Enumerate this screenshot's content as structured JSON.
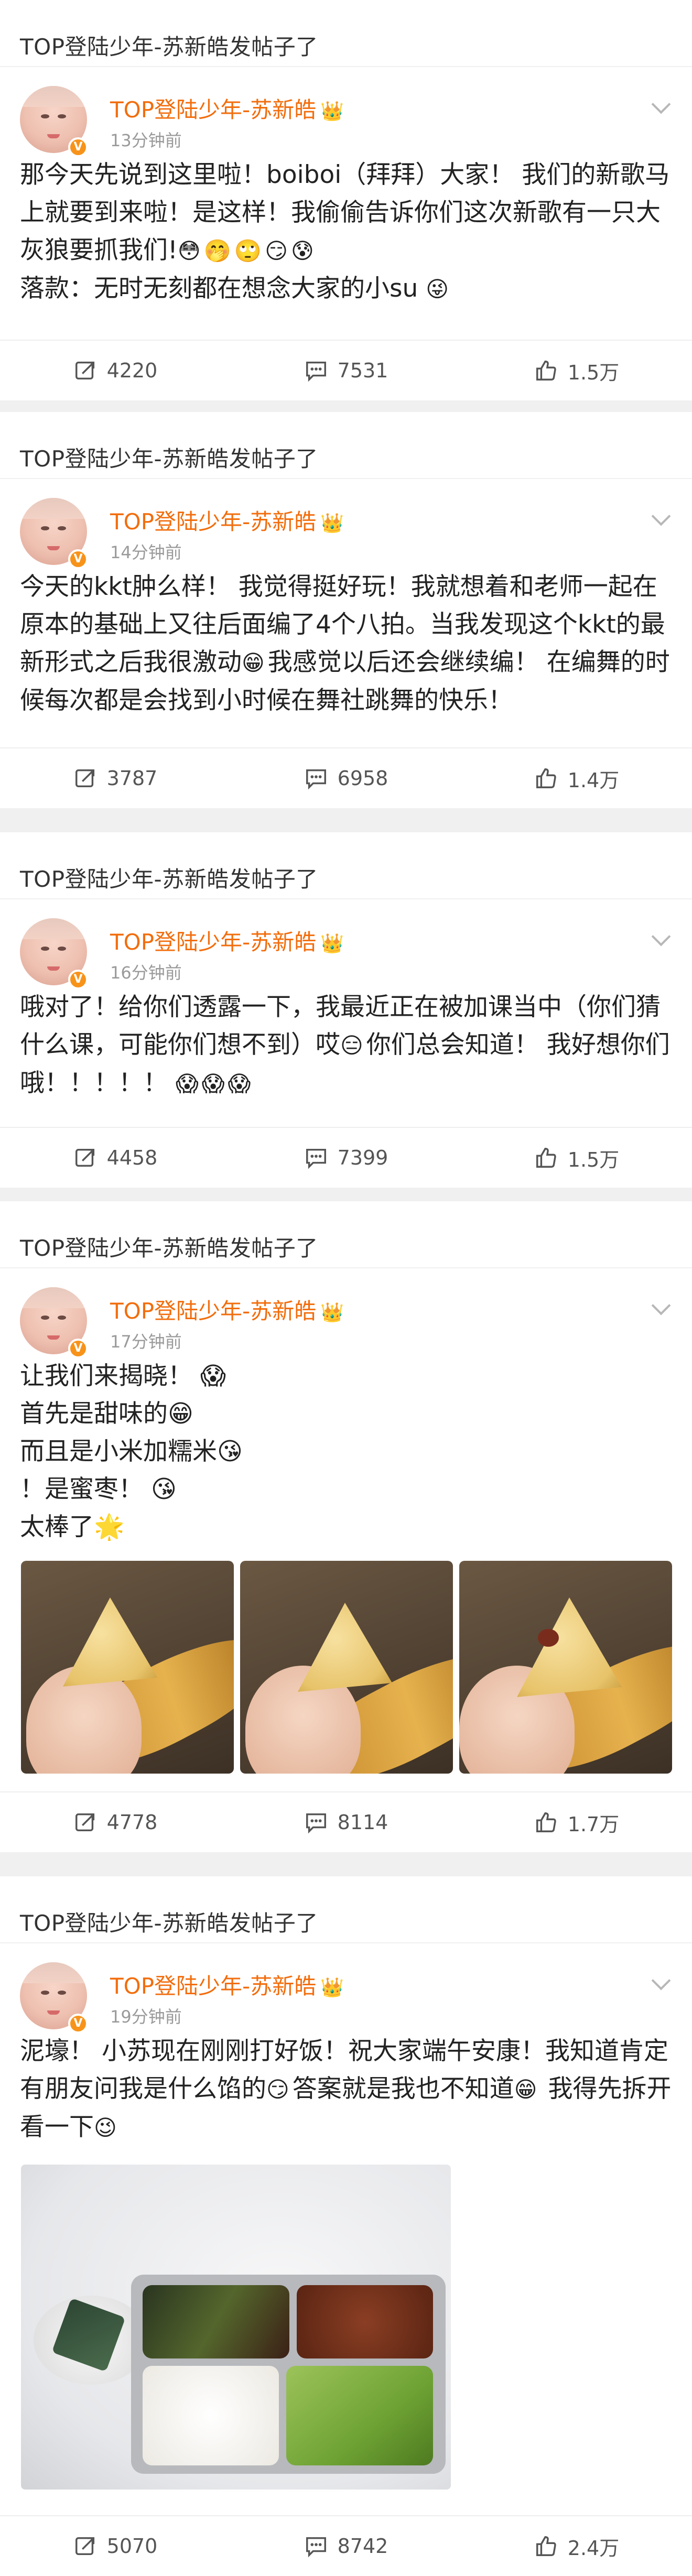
{
  "colors": {
    "name": "#f26d0c",
    "badge": "#f7931a",
    "bg": "#f0f0f0"
  },
  "posts": [
    {
      "header": "TOP登陆少年-苏新皓发帖子了",
      "author": "TOP登陆少年-苏新皓",
      "badge": "V",
      "time": "13分钟前",
      "text": "那今天先说到这里啦！boiboi（拜拜）大家！ 我们的新歌马上就要到来啦！是这样！我偷偷告诉你们这次新歌有一只大灰狼要抓我们!",
      "emojis": "😳🤭🙄😏😰",
      "text2": "落款：无时无刻都在想念大家的小su",
      "emoji2": "😜",
      "repost": "4220",
      "comment": "7531",
      "like": "1.5万"
    },
    {
      "header": "TOP登陆少年-苏新皓发帖子了",
      "author": "TOP登陆少年-苏新皓",
      "badge": "V",
      "time": "14分钟前",
      "text": "今天的kkt肿么样！ 我觉得挺好玩！我就想着和老师一起在原本的基础上又往后面编了4个八拍。当我发现这个kkt的最新形式之后我很激动",
      "emojis": "😁",
      "text2": "我感觉以后还会继续编！ 在编舞的时候每次都是会找到小时候在舞社跳舞的快乐！",
      "repost": "3787",
      "comment": "6958",
      "like": "1.4万"
    },
    {
      "header": "TOP登陆少年-苏新皓发帖子了",
      "author": "TOP登陆少年-苏新皓",
      "badge": "V",
      "time": "16分钟前",
      "text": "哦对了！给你们透露一下，我最近正在被加课当中（你们猜什么课，可能你们想不到）哎",
      "emojis": "😑",
      "text2": "你们总会知道！ 我好想你们哦！！！！！",
      "emoji2": "😱😱😱",
      "repost": "4458",
      "comment": "7399",
      "like": "1.5万"
    },
    {
      "header": "TOP登陆少年-苏新皓发帖子了",
      "author": "TOP登陆少年-苏新皓",
      "badge": "V",
      "time": "17分钟前",
      "lines": [
        "让我们来揭晓！ 😱",
        "首先是甜味的😁",
        "而且是小米加糯米😘",
        "！是蜜枣！ 😘",
        "太棒了🌟"
      ],
      "repost": "4778",
      "comment": "8114",
      "like": "1.7万"
    },
    {
      "header": "TOP登陆少年-苏新皓发帖子了",
      "author": "TOP登陆少年-苏新皓",
      "badge": "V",
      "time": "19分钟前",
      "text": "泥壕！ 小苏现在刚刚打好饭！祝大家端午安康！我知道肯定有朋友问我是什么馅的",
      "emojis": "😏",
      "text2": "答案就是我也不知道",
      "emoji2": "😁",
      "text3": "我得先拆开看一下",
      "emoji3": "😉",
      "repost": "5070",
      "comment": "8742",
      "like": "2.4万"
    }
  ]
}
